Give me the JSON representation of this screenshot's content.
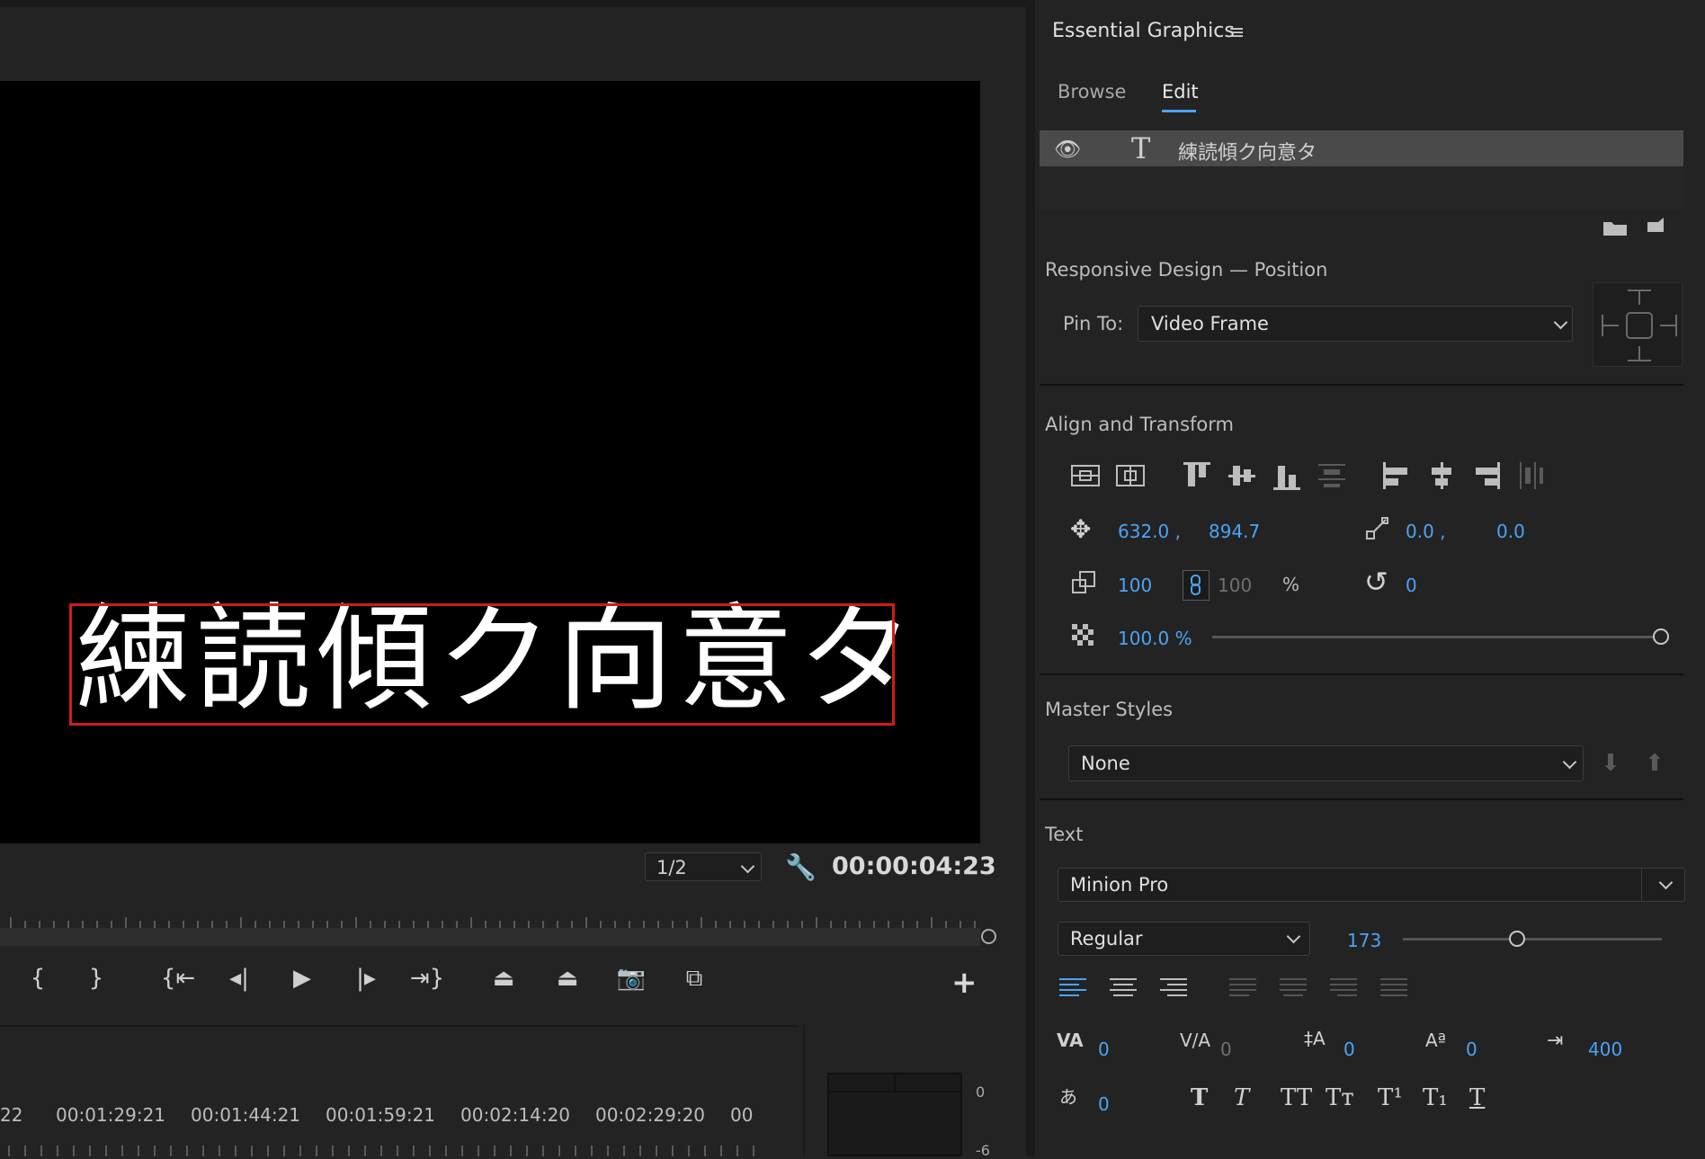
{
  "monitor": {
    "title_text": "練読傾ク向意タ",
    "resolution": "1/2",
    "timecode": "00:00:04:23"
  },
  "timeline": {
    "times": [
      "22",
      "00:01:29:21",
      "00:01:44:21",
      "00:01:59:21",
      "00:02:14:20",
      "00:02:29:20",
      "00"
    ],
    "meter_ticks": [
      "0",
      "-6"
    ]
  },
  "panel": {
    "title": "Essential Graphics",
    "tabs": {
      "browse": "Browse",
      "edit": "Edit"
    },
    "layer": {
      "name": "練読傾ク向意タ"
    },
    "responsive": {
      "title": "Responsive Design — Position",
      "pin_label": "Pin To:",
      "pin_value": "Video Frame"
    },
    "align": {
      "title": "Align and Transform",
      "pos_x": "632.0 ,",
      "pos_y": "894.7",
      "anchor_x": "0.0 ,",
      "anchor_y": "0.0",
      "scale": "100",
      "scale_h": "100",
      "scale_unit": "%",
      "rotation": "0",
      "opacity": "100.0 %",
      "opacity_level": 1.0
    },
    "master": {
      "title": "Master Styles",
      "value": "None"
    },
    "text": {
      "title": "Text",
      "font": "Minion Pro",
      "style": "Regular",
      "size": "173",
      "kerning": "0",
      "tracking": "0",
      "leading": "0",
      "baseline": "0",
      "tab_width": "400",
      "tsume": "0"
    }
  }
}
